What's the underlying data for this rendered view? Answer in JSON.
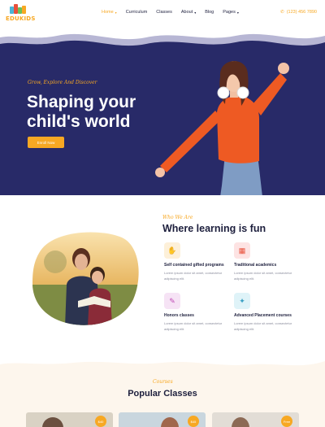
{
  "brand": {
    "logo_text": "EDUKIDS"
  },
  "nav": {
    "items": [
      {
        "label": "Home",
        "dropdown": true,
        "active": true
      },
      {
        "label": "Curriculum",
        "dropdown": false
      },
      {
        "label": "Classes",
        "dropdown": false
      },
      {
        "label": "About",
        "dropdown": true
      },
      {
        "label": "Blog",
        "dropdown": false
      },
      {
        "label": "Pages",
        "dropdown": true
      }
    ],
    "phone": "(123) 456 7890"
  },
  "hero": {
    "tagline": "Grow, Explore And Discover",
    "headline": "Shaping your child's world",
    "cta_label": "Enroll Now"
  },
  "about": {
    "script_title": "Who We Are",
    "title": "Where learning is fun",
    "features": [
      {
        "title": "Self contained gifted programs",
        "desc": "Lorem ipsum dolor sit amet, consectetur adipiscing elit.",
        "icon": "hand-icon",
        "color": "#fdf0d9"
      },
      {
        "title": "Traditional academics",
        "desc": "Lorem ipsum dolor sit amet, consectetur adipiscing elit.",
        "icon": "abc-blocks-icon",
        "color": "#fde3e3"
      },
      {
        "title": "Honors classes",
        "desc": "Lorem ipsum dolor sit amet, consectetur adipiscing elit.",
        "icon": "paint-icon",
        "color": "#f6e3f5"
      },
      {
        "title": "Advanced Placement courses",
        "desc": "Lorem ipsum dolor sit amet, consectetur adipiscing elit.",
        "icon": "telescope-icon",
        "color": "#dff3f8"
      }
    ]
  },
  "classes": {
    "script_title": "Courses",
    "title": "Popular Classes",
    "cards": [
      {
        "price": "$40"
      },
      {
        "price": "$45"
      },
      {
        "price": "Free"
      }
    ]
  },
  "colors": {
    "accent": "#f7a823",
    "navy": "#282a68",
    "dark": "#1d1f3d"
  }
}
